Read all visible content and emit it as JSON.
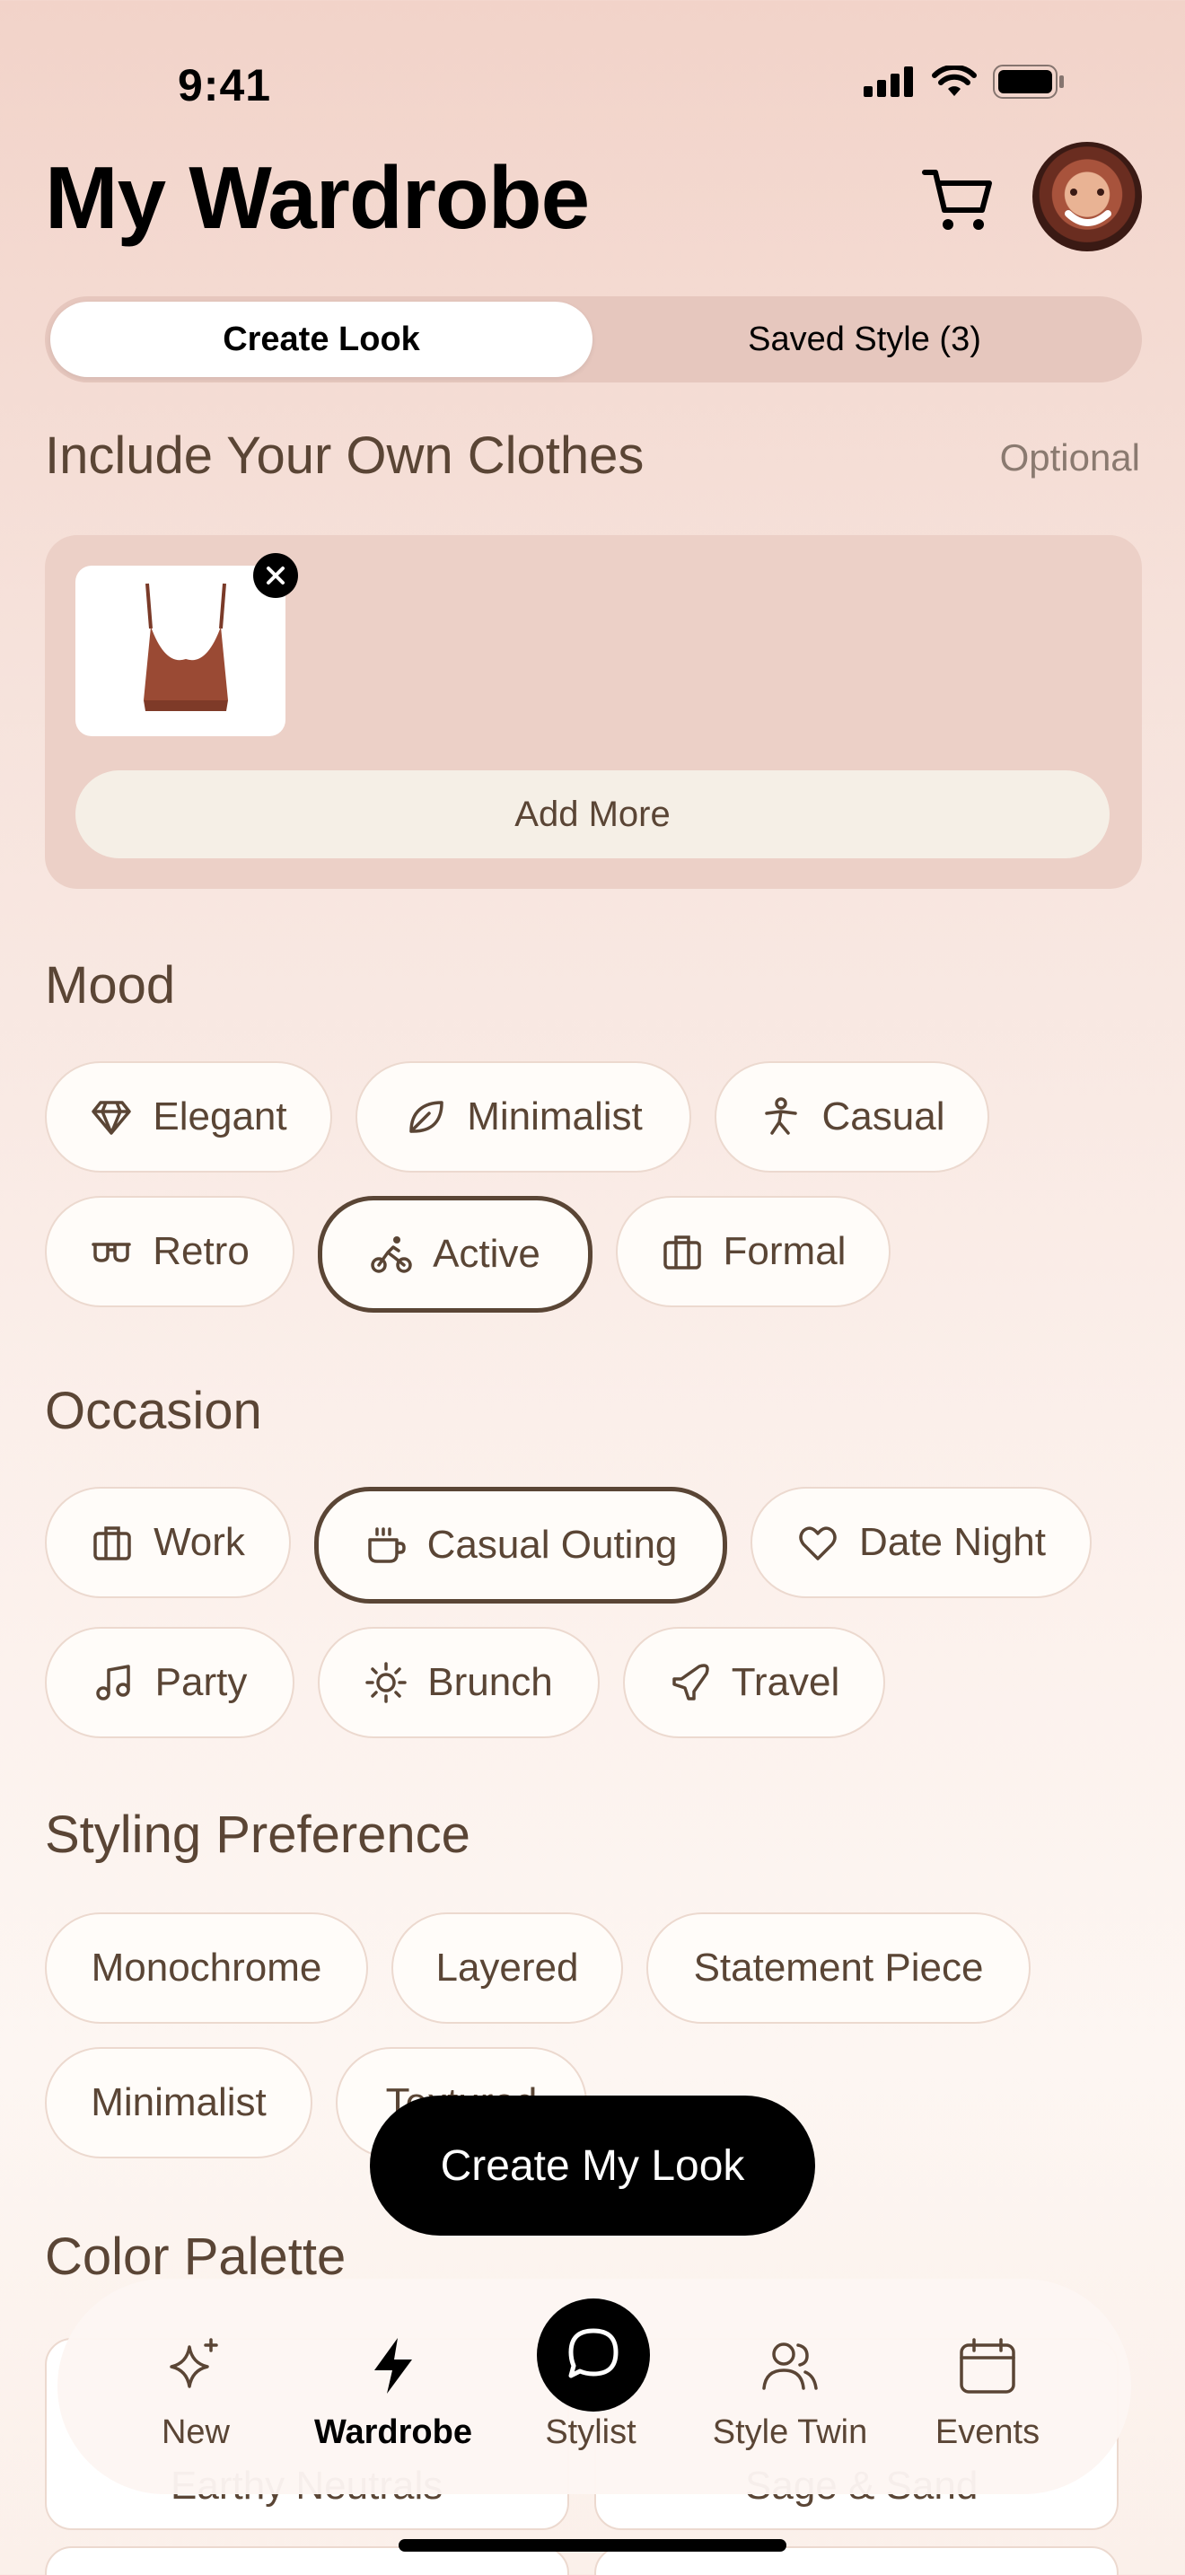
{
  "status": {
    "time": "9:41"
  },
  "header": {
    "title": "My Wardrobe"
  },
  "segments": {
    "active": "Create Look",
    "inactive": "Saved Style (3)"
  },
  "clothes": {
    "title": "Include Your Own Clothes",
    "optional": "Optional",
    "add_more": "Add More"
  },
  "mood": {
    "title": "Mood",
    "chips": [
      {
        "label": "Elegant",
        "icon": "diamond-icon"
      },
      {
        "label": "Minimalist",
        "icon": "leaf-icon"
      },
      {
        "label": "Casual",
        "icon": "person-icon"
      },
      {
        "label": "Retro",
        "icon": "glasses-icon"
      },
      {
        "label": "Active",
        "icon": "cyclist-icon",
        "selected": true
      },
      {
        "label": "Formal",
        "icon": "briefcase-icon"
      }
    ]
  },
  "occasion": {
    "title": "Occasion",
    "chips": [
      {
        "label": "Work",
        "icon": "briefcase-icon"
      },
      {
        "label": "Casual Outing",
        "icon": "coffee-icon",
        "selected": true
      },
      {
        "label": "Date Night",
        "icon": "heart-icon"
      },
      {
        "label": "Party",
        "icon": "music-note-icon"
      },
      {
        "label": "Brunch",
        "icon": "sun-icon"
      },
      {
        "label": "Travel",
        "icon": "plane-icon"
      }
    ]
  },
  "styling": {
    "title": "Styling Preference",
    "chips": [
      "Monochrome",
      "Layered",
      "Statement Piece",
      "Minimalist",
      "Textured"
    ]
  },
  "cta": {
    "label": "Create My Look"
  },
  "palette": {
    "title": "Color Palette",
    "cards": [
      "Earthy Neutrals",
      "Sage & Sand"
    ]
  },
  "tabs": [
    {
      "label": "New",
      "icon": "sparkles-icon"
    },
    {
      "label": "Wardrobe",
      "icon": "bolt-icon",
      "active": true
    },
    {
      "label": "Stylist",
      "icon": "chat-icon"
    },
    {
      "label": "Style Twin",
      "icon": "users-icon"
    },
    {
      "label": "Events",
      "icon": "calendar-icon"
    }
  ],
  "colors": {
    "accent": "#5a4535",
    "background": "#f2d3c9",
    "chip_border": "#ecd9cf",
    "cta": "#000000"
  }
}
